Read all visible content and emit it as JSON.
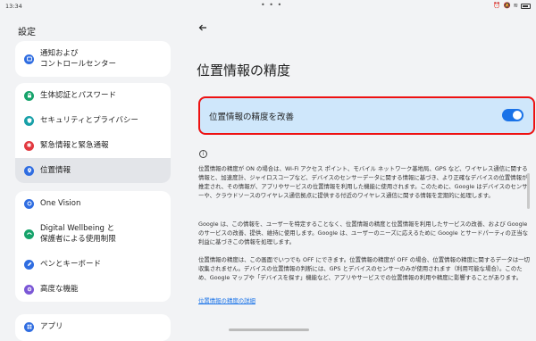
{
  "status": {
    "time": "13:34"
  },
  "sidebar": {
    "title": "設定",
    "groups": [
      {
        "items": [
          {
            "label1": "通知および",
            "label2": "コントロールセンター",
            "icon": "notification-icon",
            "color": "#2f6de1"
          }
        ]
      },
      {
        "items": [
          {
            "label": "生体認証とパスワード",
            "icon": "lock-icon",
            "color": "#16a36b"
          },
          {
            "label": "セキュリティとプライバシー",
            "icon": "shield-icon",
            "color": "#17a0a8"
          },
          {
            "label": "緊急情報と緊急通報",
            "icon": "emergency-icon",
            "color": "#e2383f"
          },
          {
            "label": "位置情報",
            "icon": "location-icon",
            "color": "#2f6de1",
            "selected": true
          }
        ]
      },
      {
        "items": [
          {
            "label": "One Vision",
            "icon": "one-vision-icon",
            "color": "#2f6de1"
          },
          {
            "label1": "Digital Wellbeing と",
            "label2": "保護者による使用制限",
            "icon": "wellbeing-icon",
            "color": "#16a36b"
          },
          {
            "label": "ペンとキーボード",
            "icon": "pen-icon",
            "color": "#2f6de1"
          },
          {
            "label": "高度な機能",
            "icon": "advanced-icon",
            "color": "#7b57d6"
          }
        ]
      },
      {
        "items": [
          {
            "label": "アプリ",
            "icon": "apps-icon",
            "color": "#2f6de1"
          }
        ]
      }
    ]
  },
  "main": {
    "title": "位置情報の精度",
    "toggle": {
      "label": "位置情報の精度を改善",
      "on": true
    },
    "para1": "位置情報の精度が ON の場合は、Wi-Fi アクセス ポイント、モバイル ネットワーク基地局、GPS など、ワイヤレス通信に関する情報と、加速度計、ジャイロスコープなど、デバイスのセンサーデータに関する情報に基づき、より正確なデバイスの位置情報が推定され、その情報が、アプリやサービスの位置情報を利用した機能に使用されます。このために、Google はデバイスのセンサーや、クラウドソースのワイヤレス通信拠点に提供する付近のワイヤレス通信に関する情報を定期的に処理します。",
    "para2": "Google は、この情報を、ユーザーを特定することなく、位置情報の精度と位置情報を利用したサービスの改善、および Google のサービスの改善、提供、維持に使用します。Google は、ユーザーのニーズに応えるために Google とサードパーティの正当な利益に基づきこの情報を処理します。",
    "para3": "位置情報の精度は、この画面でいつでも OFF にできます。位置情報の精度が OFF の場合、位置情報の精度に関するデータは一切収集されません。デバイスの位置情報の判断には、GPS とデバイスのセンサーのみが使用されます（利用可能な場合）。このため、Google マップや「デバイスを探す」機能など、アプリやサービスでの位置情報の利用や精度に影響することがあります。",
    "link": "位置情報の精度の詳細"
  }
}
